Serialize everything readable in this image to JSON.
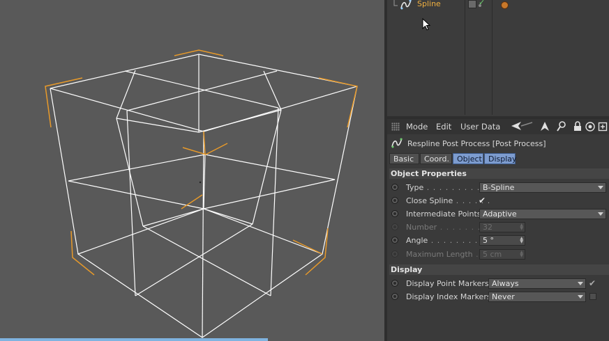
{
  "object_manager": {
    "object_name": "Spline",
    "icon": "spline-icon",
    "tag": "material-tag-icon"
  },
  "attribute_manager": {
    "menu": [
      "Mode",
      "Edit",
      "User Data"
    ],
    "toolbar_icons": [
      "back-arrow-icon",
      "up-arrow-icon",
      "search-icon",
      "lock-icon",
      "target-icon",
      "new-panel-icon"
    ],
    "object_title": "Respline Post Process [Post Process]",
    "tabs": [
      {
        "label": "Basic",
        "active": false
      },
      {
        "label": "Coord.",
        "active": false
      },
      {
        "label": "Object",
        "active": true
      },
      {
        "label": "Display",
        "active": true
      }
    ],
    "sections": {
      "object_properties": "Object Properties",
      "display": "Display"
    },
    "properties": {
      "type": {
        "label": "Type",
        "value": "B-Spline"
      },
      "close_spline": {
        "label": "Close Spline",
        "checked": true
      },
      "intermediate_points": {
        "label": "Intermediate Points",
        "value": "Adaptive"
      },
      "number": {
        "label": "Number",
        "value": "32",
        "enabled": false
      },
      "angle": {
        "label": "Angle",
        "value": "5 °"
      },
      "max_length": {
        "label": "Maximum Length",
        "value": "5 cm",
        "enabled": false
      }
    },
    "display_props": {
      "point_markers": {
        "label": "Display Point Markers",
        "value": "Always",
        "checked": true
      },
      "index_markers": {
        "label": "Display Index Markers",
        "value": "Never",
        "checked": false
      }
    }
  },
  "colors": {
    "viewport_bg": "#595959",
    "wire": "#ffffff",
    "selection_bracket": "#e89a2a",
    "active_tab": "#7d9ccf",
    "object_name": "#f0b040"
  }
}
